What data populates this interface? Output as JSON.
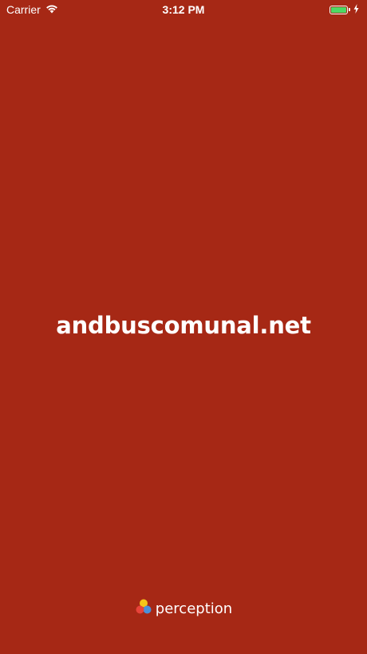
{
  "status_bar": {
    "carrier": "Carrier",
    "time": "3:12 PM",
    "icons": [
      "wifi-icon",
      "battery-icon",
      "charging-bolt-icon"
    ]
  },
  "splash": {
    "title": "andbuscomunal.net",
    "brand_label": "perception",
    "brand_logo_icon": "perception-logo-icon"
  },
  "colors": {
    "background": "#a62815",
    "text": "#ffffff",
    "battery": "#4cd964",
    "logo_yellow": "#f5c518",
    "logo_blue": "#4a90d9",
    "logo_red": "#e8433a"
  }
}
